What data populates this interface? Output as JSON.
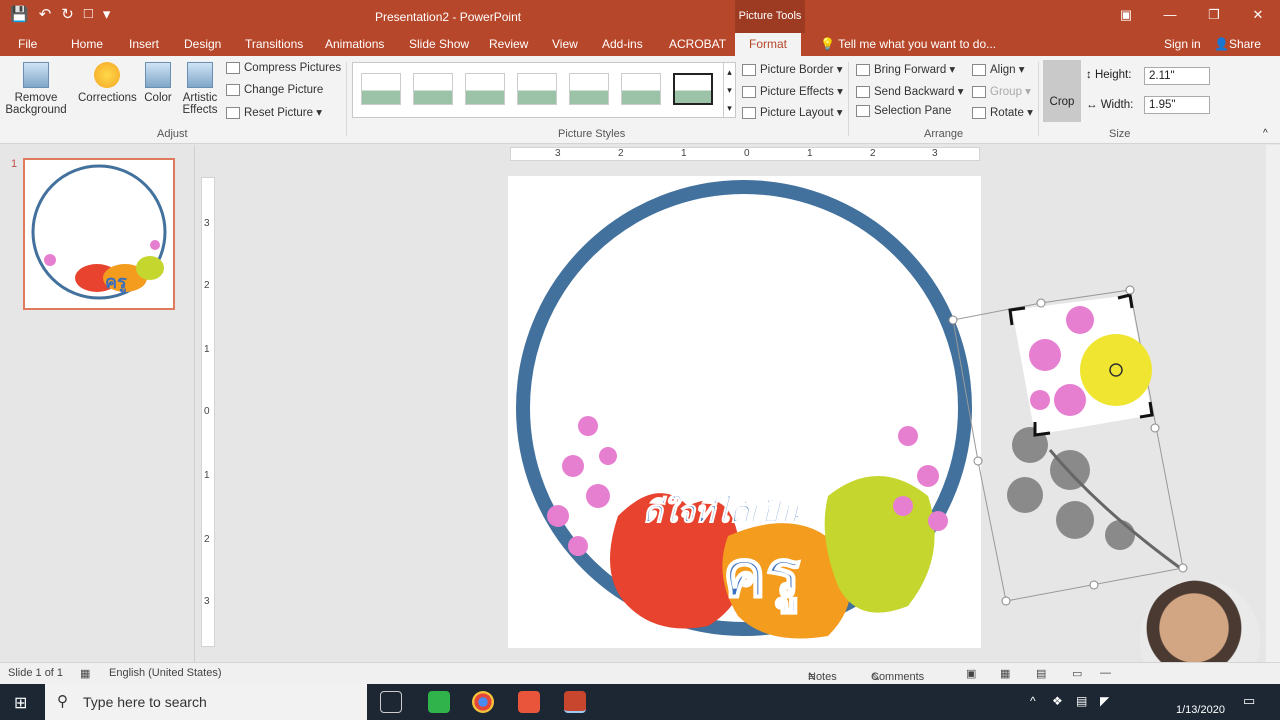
{
  "titlebar": {
    "doc_title": "Presentation2 - PowerPoint",
    "context_tab": "Picture Tools"
  },
  "tabs": [
    "File",
    "Home",
    "Insert",
    "Design",
    "Transitions",
    "Animations",
    "Slide Show",
    "Review",
    "View",
    "Add-ins",
    "ACROBAT",
    "Format"
  ],
  "tell_me": "Tell me what you want to do...",
  "sign_in": "Sign in",
  "share": "Share",
  "ribbon": {
    "remove_bg": "Remove Background",
    "corrections": "Corrections",
    "color": "Color",
    "artistic": "Artistic Effects",
    "compress": "Compress Pictures",
    "change": "Change Picture",
    "reset": "Reset Picture",
    "adjust_label": "Adjust",
    "picture_styles_label": "Picture Styles",
    "border": "Picture Border",
    "effects": "Picture Effects",
    "layout": "Picture Layout",
    "bring_forward": "Bring Forward",
    "send_backward": "Send Backward",
    "selection_pane": "Selection Pane",
    "align": "Align",
    "group": "Group",
    "rotate": "Rotate",
    "arrange_label": "Arrange",
    "crop": "Crop",
    "height_label": "Height:",
    "height_value": "2.11\"",
    "width_label": "Width:",
    "width_value": "1.95\"",
    "size_label": "Size"
  },
  "slide_number": "1",
  "ruler_h": [
    "3",
    "2",
    "1",
    "0",
    "1",
    "2",
    "3"
  ],
  "ruler_v": [
    "3",
    "2",
    "1",
    "0",
    "1",
    "2",
    "3"
  ],
  "slide_text": {
    "line1": "ดีใจที่ได้เป็น",
    "line2": "ครู"
  },
  "status": {
    "slide": "Slide 1 of 1",
    "language": "English (United States)",
    "notes": "Notes",
    "comments": "Comments"
  },
  "taskbar": {
    "search": "Type here to search",
    "date": "1/13/2020"
  },
  "colors": {
    "accent": "#b7472a",
    "circle": "#41719c"
  }
}
